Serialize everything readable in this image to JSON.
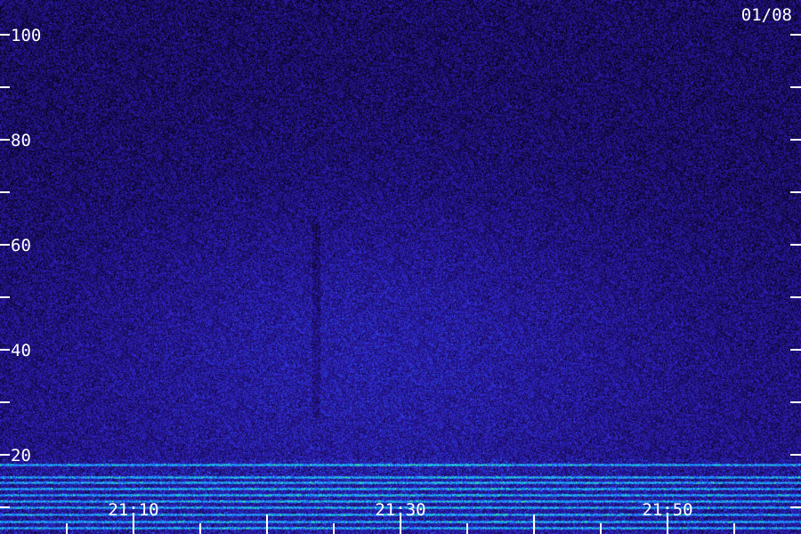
{
  "date_label": "01/08",
  "chart_data": {
    "type": "heatmap",
    "title": "",
    "xlabel": "",
    "ylabel": "",
    "x_tick_labels": [
      "21:10",
      "21:30",
      "21:50"
    ],
    "y_tick_labels": [
      "100",
      "80",
      "60",
      "40",
      "20"
    ],
    "y_tick_values": [
      100,
      80,
      60,
      40,
      20
    ],
    "y_minor_tick_values": [
      90,
      70,
      50,
      30,
      10
    ],
    "ylim": [
      0,
      102
    ],
    "colormap": [
      "#000000",
      "#1a0d66",
      "#3320c8",
      "#1f6cff",
      "#18d6e6",
      "#4cff3a",
      "#ffff40"
    ],
    "grid": false,
    "legend": "none"
  }
}
